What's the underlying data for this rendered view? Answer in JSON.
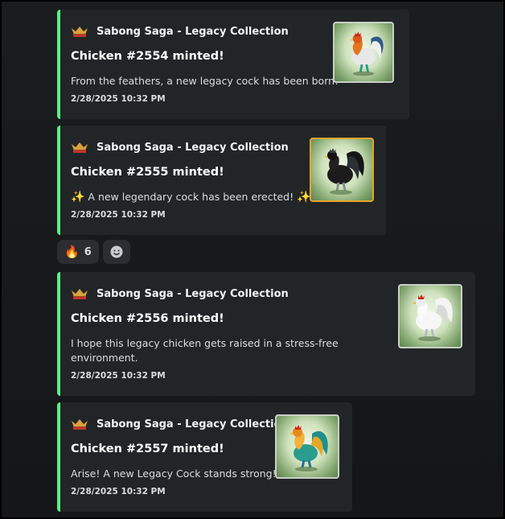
{
  "messages": [
    {
      "author": "Sabong Saga - Legacy Collection",
      "title": "Chicken #2554 minted!",
      "description": "From the feathers, a new legacy cock has been born!",
      "timestamp": "2/28/2025 10:32 PM",
      "thumbnail_icon": "rooster-orange-icon"
    },
    {
      "author": "Sabong Saga - Legacy Collection",
      "title": "Chicken #2555 minted!",
      "description_prefix": "✨",
      "description": "A new legendary cock has been erected!",
      "description_suffix": "✨",
      "timestamp": "2/28/2025 10:32 PM",
      "thumbnail_icon": "rooster-black-icon"
    },
    {
      "author": "Sabong Saga - Legacy Collection",
      "title": "Chicken #2556 minted!",
      "description_line1": "I hope this legacy chicken gets raised in a stress-free",
      "description_line2": "environment.",
      "timestamp": "2/28/2025 10:32 PM",
      "thumbnail_icon": "rooster-white-icon"
    },
    {
      "author": "Sabong Saga - Legacy Collection",
      "title": "Chicken #2557 minted!",
      "description": "Arise! A new Legacy Cock stands strong!",
      "timestamp": "2/28/2025 10:32 PM",
      "thumbnail_icon": "rooster-teal-icon"
    }
  ],
  "reactions": [
    {
      "emoji": "🔥",
      "count": "6"
    },
    {
      "icon": "add-reaction-icon"
    }
  ],
  "colors": {
    "embed_accent": "#57f287",
    "embed_bg": "#222527",
    "gold_border": "#e7a52a"
  }
}
